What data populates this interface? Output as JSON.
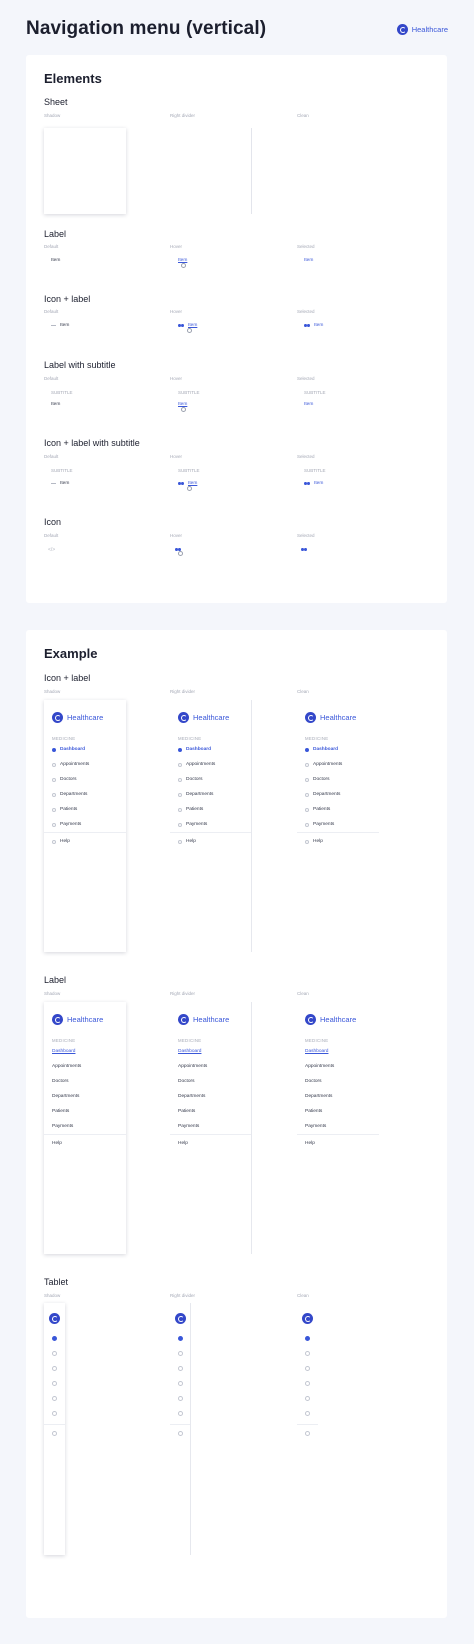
{
  "header": {
    "title": "Navigation menu (vertical)",
    "brand": "Healthcare"
  },
  "elements": {
    "title": "Elements",
    "sheet": {
      "title": "Sheet",
      "cols": [
        "Shadow",
        "Right divider",
        "Clean"
      ]
    },
    "label": {
      "title": "Label",
      "cols": [
        "Default",
        "Hover",
        "Selected"
      ],
      "item": "Item"
    },
    "icon_label": {
      "title": "Icon + label",
      "cols": [
        "Default",
        "Hover",
        "Selected"
      ],
      "item": "Item"
    },
    "label_subtitle": {
      "title": "Label with subtitle",
      "cols": [
        "Default",
        "Hover",
        "Selected"
      ],
      "subtitle": "SUBTITLE",
      "item": "Item"
    },
    "icon_label_subtitle": {
      "title": "Icon + label with subtitle",
      "cols": [
        "Default",
        "Hover",
        "Selected"
      ],
      "subtitle": "SUBTITLE",
      "item": "Item"
    },
    "icon": {
      "title": "Icon",
      "cols": [
        "Default",
        "Hover",
        "Selected"
      ],
      "glyph": "</>"
    }
  },
  "example": {
    "title": "Example",
    "icon_label": {
      "title": "Icon + label",
      "cols": [
        "Shadow",
        "Right divider",
        "Clean"
      ]
    },
    "label": {
      "title": "Label",
      "cols": [
        "Shadow",
        "Right divider",
        "Clean"
      ]
    },
    "tablet": {
      "title": "Tablet",
      "cols": [
        "Shadow",
        "Right divider",
        "Clean"
      ]
    },
    "nav": {
      "brand": "Healthcare",
      "category": "MEDICINE",
      "items": [
        "Dashboard",
        "Appointments",
        "Doctors",
        "Departments",
        "Patients",
        "Payments"
      ],
      "help": "Help"
    }
  }
}
